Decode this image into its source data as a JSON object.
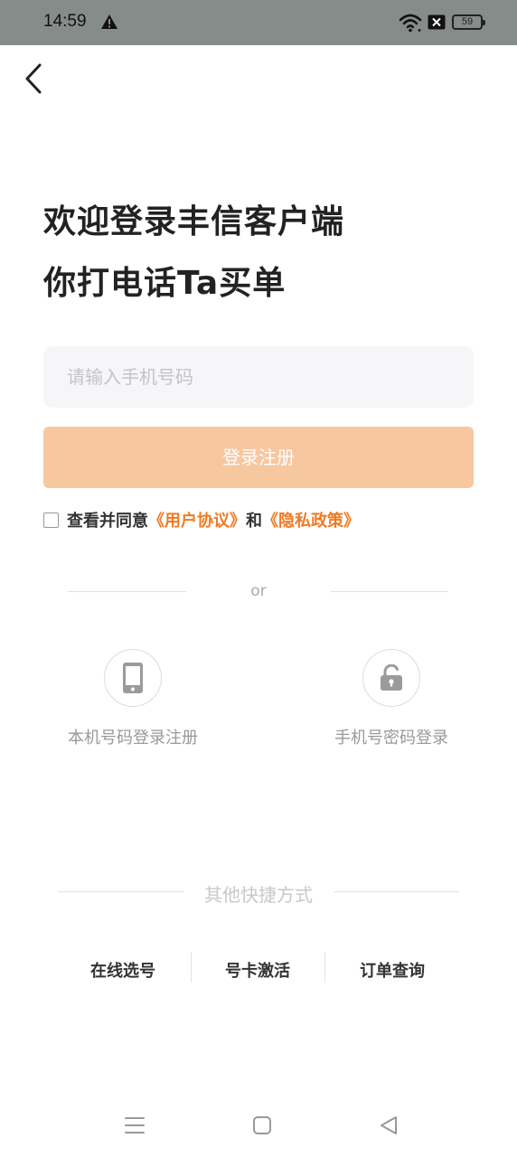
{
  "status_bar": {
    "time": "14:59",
    "battery_level": "59",
    "icons": [
      "warning-icon",
      "wifi-icon",
      "no-sim-icon",
      "battery-icon"
    ]
  },
  "header": {
    "back_icon": "chevron-left-icon"
  },
  "welcome": {
    "title": "欢迎登录丰信客户端",
    "subtitle": "你打电话Ta买单"
  },
  "login_form": {
    "phone_placeholder": "请输入手机号码",
    "phone_value": "",
    "submit_label": "登录注册",
    "agreement_checked": false,
    "agreement_prefix": "查看并同意",
    "user_agreement_link": "《用户协议》",
    "agreement_and": "和",
    "privacy_policy_link": "《隐私政策》"
  },
  "divider_or": "or",
  "login_options": [
    {
      "label": "本机号码登录注册",
      "icon": "mobile-phone-icon"
    },
    {
      "label": "手机号密码登录",
      "icon": "lock-icon"
    }
  ],
  "other_methods": {
    "title": "其他快捷方式",
    "links": [
      "在线选号",
      "号卡激活",
      "订单查询"
    ]
  },
  "navigation_bar": {
    "icons": [
      "menu-icon",
      "home-icon",
      "back-triangle-icon"
    ]
  },
  "colors": {
    "accent": "#f07a22",
    "button_disabled": "#f7c7a0",
    "status_bar": "#868c8a",
    "input_background": "#f6f6f9"
  }
}
